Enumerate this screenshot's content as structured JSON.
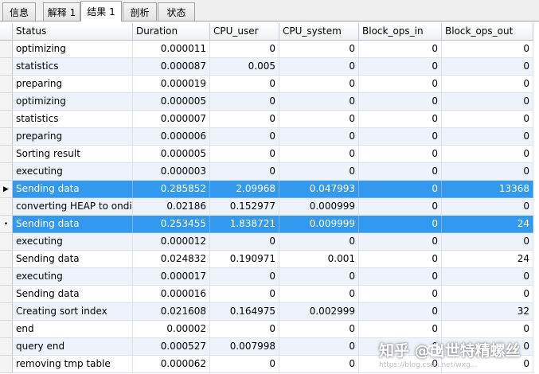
{
  "tabs": [
    {
      "label": "信息"
    },
    {
      "label": "解释 1"
    },
    {
      "label": "结果 1"
    },
    {
      "label": "剖析"
    },
    {
      "label": "状态"
    }
  ],
  "active_tab": 2,
  "columns": [
    "Status",
    "Duration",
    "CPU_user",
    "CPU_system",
    "Block_ops_in",
    "Block_ops_out"
  ],
  "rows": [
    {
      "status": "optimizing",
      "duration": "0.000011",
      "cpu_user": "0",
      "cpu_system": "0",
      "block_ops_in": "0",
      "block_ops_out": "0"
    },
    {
      "status": "statistics",
      "duration": "0.000087",
      "cpu_user": "0.005",
      "cpu_system": "0",
      "block_ops_in": "0",
      "block_ops_out": "0"
    },
    {
      "status": "preparing",
      "duration": "0.000019",
      "cpu_user": "0",
      "cpu_system": "0",
      "block_ops_in": "0",
      "block_ops_out": "0"
    },
    {
      "status": "optimizing",
      "duration": "0.000005",
      "cpu_user": "0",
      "cpu_system": "0",
      "block_ops_in": "0",
      "block_ops_out": "0"
    },
    {
      "status": "statistics",
      "duration": "0.000007",
      "cpu_user": "0",
      "cpu_system": "0",
      "block_ops_in": "0",
      "block_ops_out": "0"
    },
    {
      "status": "preparing",
      "duration": "0.000006",
      "cpu_user": "0",
      "cpu_system": "0",
      "block_ops_in": "0",
      "block_ops_out": "0"
    },
    {
      "status": "Sorting result",
      "duration": "0.000005",
      "cpu_user": "0",
      "cpu_system": "0",
      "block_ops_in": "0",
      "block_ops_out": "0"
    },
    {
      "status": "executing",
      "duration": "0.000003",
      "cpu_user": "0",
      "cpu_system": "0",
      "block_ops_in": "0",
      "block_ops_out": "0"
    },
    {
      "status": "Sending data",
      "duration": "0.285852",
      "cpu_user": "2.09968",
      "cpu_system": "0.047993",
      "block_ops_in": "0",
      "block_ops_out": "13368",
      "selected": true,
      "indicator": "▶"
    },
    {
      "status": "converting HEAP to ondisk",
      "duration": "0.02186",
      "cpu_user": "0.152977",
      "cpu_system": "0.000999",
      "block_ops_in": "0",
      "block_ops_out": "0"
    },
    {
      "status": "Sending data",
      "duration": "0.253455",
      "cpu_user": "1.838721",
      "cpu_system": "0.009999",
      "block_ops_in": "0",
      "block_ops_out": "24",
      "selected": true,
      "indicator": "•"
    },
    {
      "status": "executing",
      "duration": "0.000012",
      "cpu_user": "0",
      "cpu_system": "0",
      "block_ops_in": "0",
      "block_ops_out": "0"
    },
    {
      "status": "Sending data",
      "duration": "0.024832",
      "cpu_user": "0.190971",
      "cpu_system": "0.001",
      "block_ops_in": "0",
      "block_ops_out": "24"
    },
    {
      "status": "executing",
      "duration": "0.000017",
      "cpu_user": "0",
      "cpu_system": "0",
      "block_ops_in": "0",
      "block_ops_out": "0"
    },
    {
      "status": "Sending data",
      "duration": "0.000016",
      "cpu_user": "0",
      "cpu_system": "0",
      "block_ops_in": "0",
      "block_ops_out": "0"
    },
    {
      "status": "Creating sort index",
      "duration": "0.021608",
      "cpu_user": "0.164975",
      "cpu_system": "0.002999",
      "block_ops_in": "0",
      "block_ops_out": "32"
    },
    {
      "status": "end",
      "duration": "0.00002",
      "cpu_user": "0",
      "cpu_system": "0",
      "block_ops_in": "0",
      "block_ops_out": "0"
    },
    {
      "status": "query end",
      "duration": "0.000527",
      "cpu_user": "0.007998",
      "cpu_system": "0",
      "block_ops_in": "0",
      "block_ops_out": "0"
    },
    {
      "status": "removing tmp table",
      "duration": "0.000062",
      "cpu_user": "0",
      "cpu_system": "0",
      "block_ops_in": "0",
      "block_ops_out": "0"
    }
  ],
  "watermark": {
    "text": "知乎  @出世特精螺丝",
    "url": "https://blog.csdn.net/wxg...",
    "icon": "zhihu-mascot-icon"
  },
  "colors": {
    "selection": "#3399ee",
    "alt_row": "#eef3fb"
  }
}
